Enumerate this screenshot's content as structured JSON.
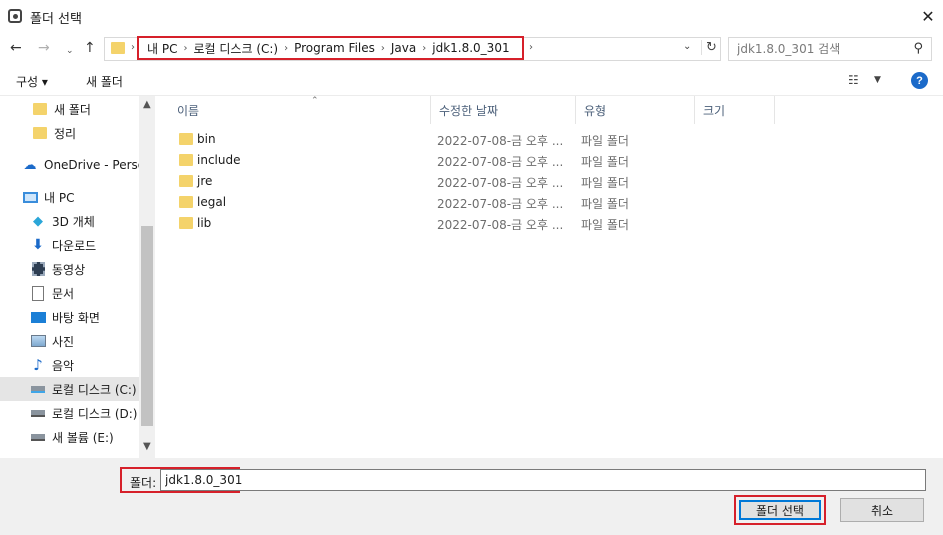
{
  "window": {
    "title": "폴더 선택"
  },
  "address": {
    "crumbs": [
      "내 PC",
      "로컬 디스크 (C:)",
      "Program Files",
      "Java",
      "jdk1.8.0_301"
    ]
  },
  "search": {
    "placeholder": "jdk1.8.0_301 검색"
  },
  "toolbar": {
    "organize": "구성 ▾",
    "new_folder": "새 폴더"
  },
  "sidebar": {
    "items": [
      {
        "label": "새 폴더",
        "icon": "folder-icon"
      },
      {
        "label": "정리",
        "icon": "folder-icon"
      },
      {
        "label": "OneDrive - Personal",
        "icon": "cloud-icon"
      },
      {
        "label": "내 PC",
        "icon": "pc-icon"
      },
      {
        "label": "3D 개체",
        "icon": "cube-icon"
      },
      {
        "label": "다운로드",
        "icon": "download-icon"
      },
      {
        "label": "동영상",
        "icon": "video-icon"
      },
      {
        "label": "문서",
        "icon": "document-icon"
      },
      {
        "label": "바탕 화면",
        "icon": "desktop-icon"
      },
      {
        "label": "사진",
        "icon": "picture-icon"
      },
      {
        "label": "음악",
        "icon": "music-icon"
      },
      {
        "label": "로컬 디스크 (C:)",
        "icon": "drive-icon"
      },
      {
        "label": "로컬 디스크 (D:)",
        "icon": "drive-icon"
      },
      {
        "label": "새 볼륨 (E:)",
        "icon": "drive-icon"
      }
    ]
  },
  "columns": {
    "name": "이름",
    "modified": "수정한 날짜",
    "type": "유형",
    "size": "크기"
  },
  "files": [
    {
      "name": "bin",
      "modified": "2022-07-08-금 오후 ...",
      "type": "파일 폴더"
    },
    {
      "name": "include",
      "modified": "2022-07-08-금 오후 ...",
      "type": "파일 폴더"
    },
    {
      "name": "jre",
      "modified": "2022-07-08-금 오후 ...",
      "type": "파일 폴더"
    },
    {
      "name": "legal",
      "modified": "2022-07-08-금 오후 ...",
      "type": "파일 폴더"
    },
    {
      "name": "lib",
      "modified": "2022-07-08-금 오후 ...",
      "type": "파일 폴더"
    }
  ],
  "footer": {
    "folder_label": "폴더:",
    "folder_value": "jdk1.8.0_301",
    "select_button": "폴더 선택",
    "cancel_button": "취소"
  },
  "colors": {
    "highlight": "#d6202a",
    "folder": "#f4d36b",
    "accent": "#0078d7"
  }
}
